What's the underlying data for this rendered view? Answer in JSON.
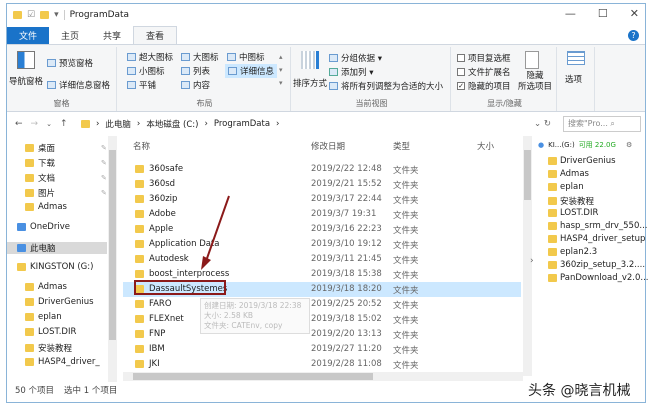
{
  "title": "ProgramData",
  "window_controls": {
    "minimize": "—",
    "maximize": "☐",
    "close": "✕"
  },
  "tabs": [
    "文件",
    "主页",
    "共享",
    "查看"
  ],
  "ribbon": {
    "panes": {
      "nav_pane": "导航窗格",
      "preview": "预览窗格",
      "details": "详细信息窗格",
      "label": "窗格"
    },
    "layout": {
      "items": [
        "超大图标",
        "大图标",
        "中图标",
        "小图标",
        "列表",
        "详细信息",
        "平铺",
        "内容"
      ],
      "label": "布局"
    },
    "current_view": {
      "sort": "排序方式",
      "group": "分组依据 ▾",
      "add_col": "添加列 ▾",
      "fit": "将所有列调整为合适的大小",
      "label": "当前视图"
    },
    "show_hide": {
      "checkboxes": "项目复选框",
      "extensions": "文件扩展名",
      "hidden": "隐藏的项目",
      "hide_sel": "隐藏\n所选项目",
      "label": "显示/隐藏"
    },
    "options": "选项"
  },
  "address": {
    "crumbs": [
      "此电脑",
      "本地磁盘 (C:)",
      "ProgramData"
    ],
    "search_placeholder": "搜索\"Pro... ⌕"
  },
  "nav": [
    "桌面",
    "下载",
    "文档",
    "图片",
    "Admas",
    "OneDrive",
    "此电脑",
    "KINGSTON (G:)",
    "Admas",
    "DriverGenius",
    "eplan",
    "LOST.DIR",
    "安装教程",
    "HASP4_driver_"
  ],
  "columns": {
    "name": "名称",
    "date": "修改日期",
    "type": "类型",
    "size": "大小"
  },
  "files": [
    {
      "name": "360safe",
      "date": "2019/2/22 12:48",
      "type": "文件夹"
    },
    {
      "name": "360sd",
      "date": "2019/2/21 15:52",
      "type": "文件夹"
    },
    {
      "name": "360zip",
      "date": "2019/3/17 22:44",
      "type": "文件夹"
    },
    {
      "name": "Adobe",
      "date": "2019/3/7 19:31",
      "type": "文件夹"
    },
    {
      "name": "Apple",
      "date": "2019/3/16 22:23",
      "type": "文件夹"
    },
    {
      "name": "Application Data",
      "date": "2019/3/10 19:12",
      "type": "文件夹"
    },
    {
      "name": "Autodesk",
      "date": "2019/3/11 21:45",
      "type": "文件夹"
    },
    {
      "name": "boost_interprocess",
      "date": "2019/3/18 15:38",
      "type": "文件夹"
    },
    {
      "name": "DassaultSystemes",
      "date": "2019/3/18 18:20",
      "type": "文件夹"
    },
    {
      "name": "FARO",
      "date": "2019/2/25 20:52",
      "type": "文件夹"
    },
    {
      "name": "FLEXnet",
      "date": "2019/3/18 15:02",
      "type": "文件夹"
    },
    {
      "name": "FNP",
      "date": "2019/2/20 13:13",
      "type": "文件夹"
    },
    {
      "name": "IBM",
      "date": "2019/2/27 11:20",
      "type": "文件夹"
    },
    {
      "name": "JKI",
      "date": "2019/2/28 11:08",
      "type": "文件夹"
    }
  ],
  "tooltip": [
    "创建日期: 2019/3/18 22:38",
    "大小: 2.58 KB",
    "文件夹: CATEnv, copy"
  ],
  "right_panel": {
    "drive": "KI...(G:)",
    "free": "可用 22.0G",
    "items": [
      "DriverGenius",
      "Admas",
      "eplan",
      "安装教程",
      "LOST.DIR",
      "hasp_srm_drv_550...",
      "HASP4_driver_setup",
      "eplan2.3",
      "360zip_setup_3.2....",
      "PanDownload_v2.0..."
    ]
  },
  "status": {
    "count": "50 个项目",
    "selected": "选中 1 个项目"
  },
  "watermark": "头条 @晓言机械"
}
